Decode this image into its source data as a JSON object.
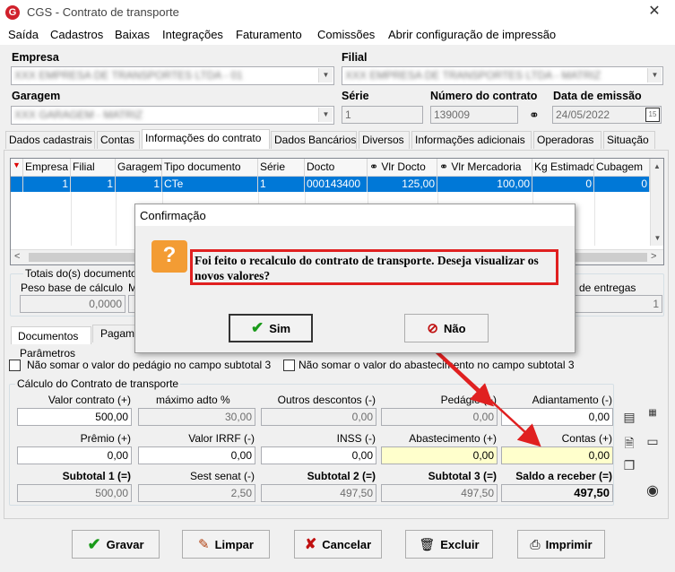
{
  "window": {
    "title": "CGS - Contrato de transporte",
    "close": "✕"
  },
  "menu": [
    "Saída",
    "Cadastros",
    "Baixas",
    "Integrações",
    "Faturamento",
    "Comissões",
    "Abrir configuração de impressão"
  ],
  "header": {
    "empresa_label": "Empresa",
    "filial_label": "Filial",
    "garagem_label": "Garagem",
    "serie_label": "Série",
    "numero_label": "Número do contrato",
    "data_label": "Data de emissão",
    "serie_value": "1",
    "numero_value": "139009",
    "data_value": "24/05/2022"
  },
  "tabs": [
    "Dados cadastrais",
    "Contas",
    "Informações do contrato",
    "Dados Bancários",
    "Diversos",
    "Informações adicionais",
    "Operadoras",
    "Situação"
  ],
  "grid": {
    "columns": [
      "Empresa",
      "Filial",
      "Garagem",
      "Tipo documento",
      "Série",
      "Docto",
      "Vlr Docto",
      "Vlr Mercadoria",
      "Kg Estimado",
      "Cubagem"
    ],
    "rows": [
      [
        "1",
        "1",
        "1",
        "CTe",
        "1",
        "000143400",
        "125,00",
        "100,00",
        "0",
        "0"
      ]
    ]
  },
  "totais": {
    "title": "Totais do(s) documento",
    "peso_label": "Peso base de cálculo",
    "peso_value": "0,0000",
    "m_label": "M",
    "entregas_label": "de entregas",
    "entregas_value": "1"
  },
  "subtabs": [
    "Documentos",
    "Pagam"
  ],
  "parametros": {
    "title": "Parâmetros",
    "opt1": "Não somar o valor do pedágio no campo subtotal 3",
    "opt2": "Não somar o valor do abastecimento no campo subtotal 3"
  },
  "calculo": {
    "title": "Cálculo do Contrato de transporte",
    "valor_contrato_label": "Valor contrato (+)",
    "valor_contrato": "500,00",
    "maximo_label": "máximo adto %",
    "maximo": "30,00",
    "outros_label": "Outros descontos (-)",
    "outros": "0,00",
    "pedagio_label": "Pedágio (+)",
    "pedagio": "0,00",
    "adiantamento_label": "Adiantamento (-)",
    "adiantamento": "0,00",
    "premio_label": "Prêmio (+)",
    "premio": "0,00",
    "irrf_label": "Valor IRRF (-)",
    "irrf": "0,00",
    "inss_label": "INSS (-)",
    "inss": "0,00",
    "abastecimento_label": "Abastecimento (+)",
    "abastecimento": "0,00",
    "contas_label": "Contas (+)",
    "contas": "0,00",
    "sub1_label": "Subtotal 1 (=)",
    "sub1": "500,00",
    "sest_label": "Sest senat (-)",
    "sest": "2,50",
    "sub2_label": "Subtotal 2 (=)",
    "sub2": "497,50",
    "sub3_label": "Subtotal 3 (=)",
    "sub3": "497,50",
    "saldo_label": "Saldo a receber (=)",
    "saldo": "497,50"
  },
  "buttons": {
    "gravar": "Gravar",
    "limpar": "Limpar",
    "cancelar": "Cancelar",
    "excluir": "Excluir",
    "imprimir": "Imprimir"
  },
  "dialog": {
    "title": "Confirmação",
    "message_line1": "Foi feito o recalculo do contrato de transporte. Deseja visualizar os",
    "message_line2": "novos valores?",
    "yes": "Sim",
    "no": "Não"
  },
  "colors": {
    "selection": "#0078d7",
    "highlight": "#e02020",
    "question_icon": "#f39c34",
    "logo": "#d0202b"
  }
}
